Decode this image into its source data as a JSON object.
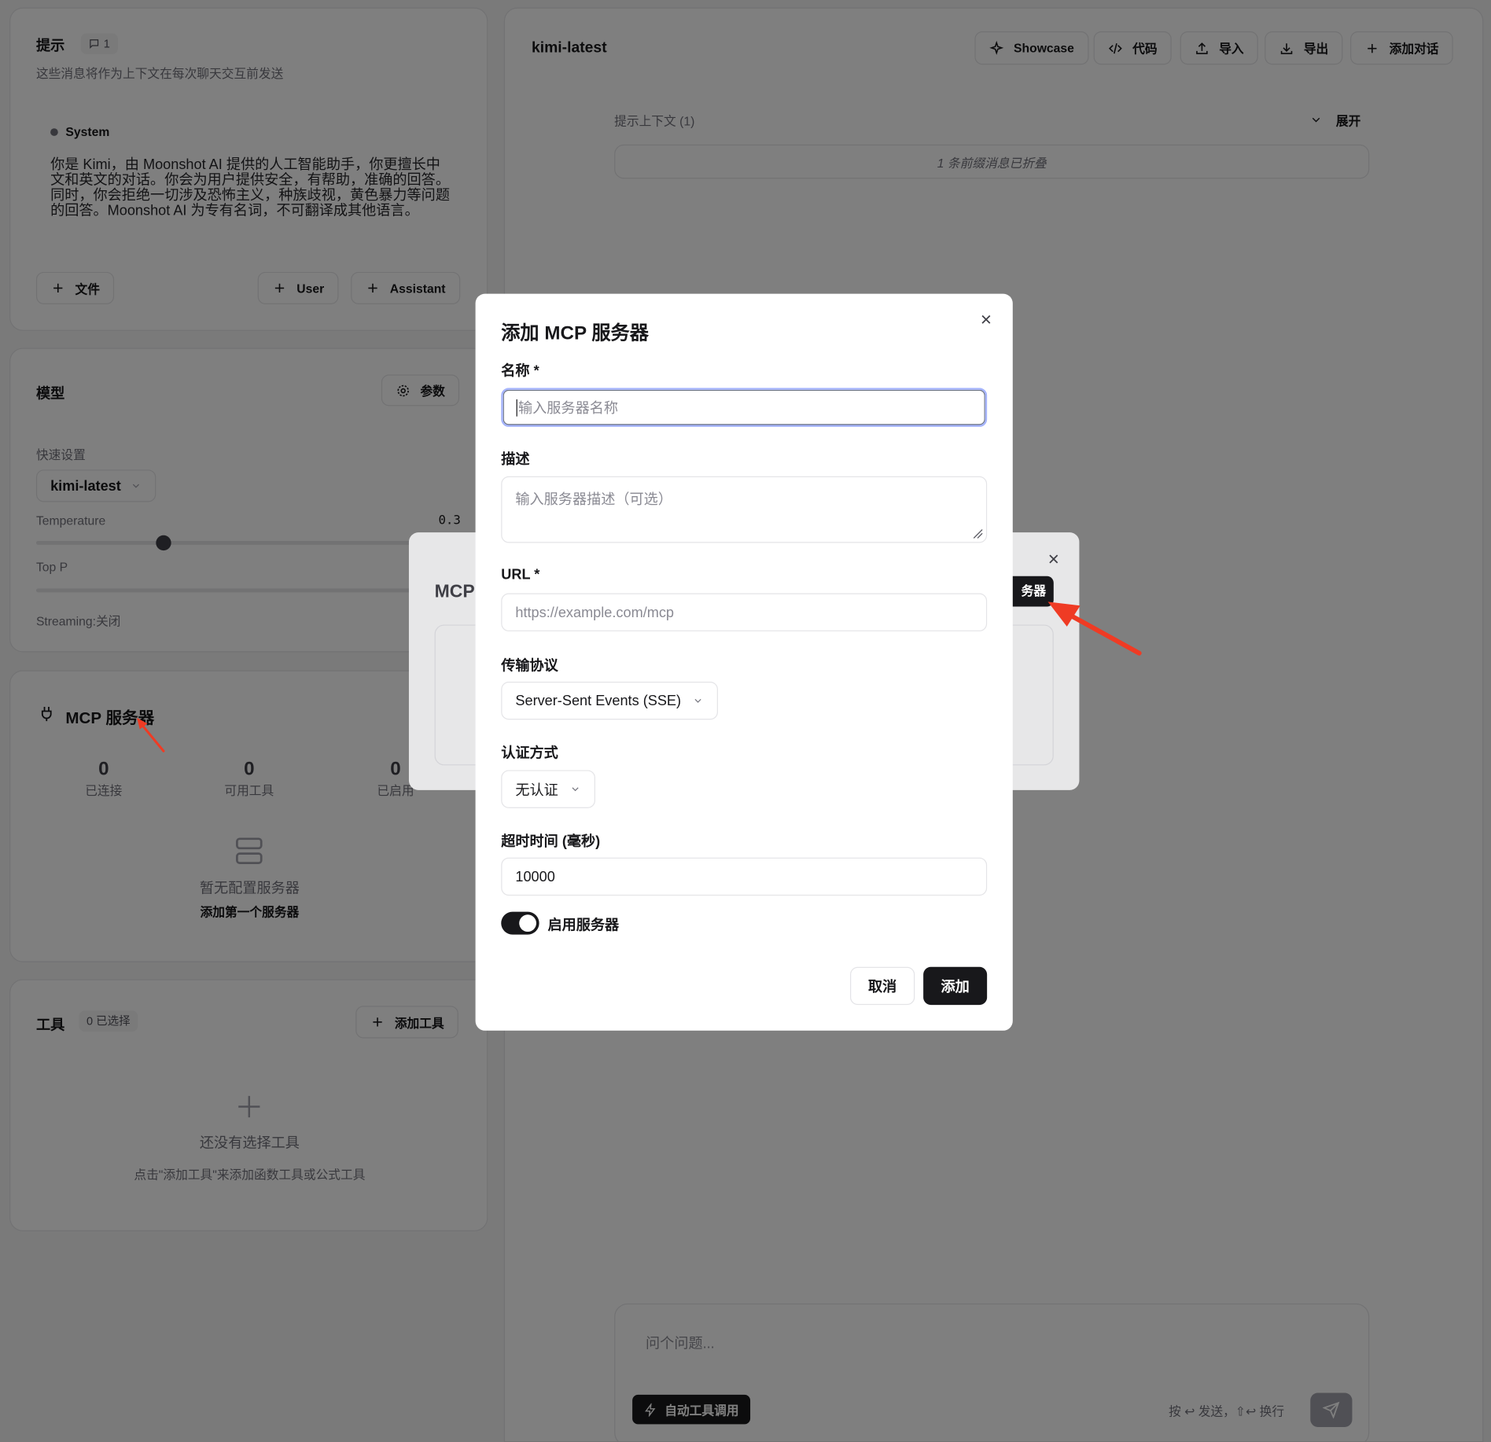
{
  "left": {
    "prompt": {
      "title": "提示",
      "count": "1",
      "subtitle": "这些消息将作为上下文在每次聊天交互前发送",
      "role": "System",
      "system_text": "你是 Kimi，由 Moonshot AI 提供的人工智能助手，你更擅长中文和英文的对话。你会为用户提供安全，有帮助，准确的回答。同时，你会拒绝一切涉及恐怖主义，种族歧视，黄色暴力等问题的回答。Moonshot AI 为专有名词，不可翻译成其他语言。",
      "add_file": "文件",
      "add_user": "User",
      "add_assistant": "Assistant"
    },
    "model": {
      "title": "模型",
      "params": "参数",
      "quick": "快速设置",
      "model_select": "kimi-latest",
      "temperature_label": "Temperature",
      "temperature_value": "0.3",
      "temperature_fraction": 0.3,
      "top_p_label": "Top P",
      "streaming": "Streaming:关闭"
    },
    "mcp": {
      "title": "MCP 服务器",
      "connected_value": "0",
      "connected_label": "已连接",
      "tools_value": "0",
      "tools_label": "可用工具",
      "enabled_value": "0",
      "enabled_label": "已启用",
      "empty": "暂无配置服务器",
      "add_first": "添加第一个服务器"
    },
    "tools": {
      "title": "工具",
      "selected": "0 已选择",
      "add": "添加工具",
      "empty": "还没有选择工具",
      "hint": "点击\"添加工具\"来添加函数工具或公式工具"
    }
  },
  "right": {
    "title": "kimi-latest",
    "toolbar": {
      "showcase": "Showcase",
      "code": "代码",
      "import": "导入",
      "export": "导出",
      "add_conv": "添加对话"
    },
    "context_label": "提示上下文 (1)",
    "expand": "展开",
    "collapsed": "1 条前缀消息已折叠",
    "input_placeholder": "问个问题...",
    "auto_tool": "自动工具调用",
    "shortcut": "按 ↩ 发送，⇧↩ 换行"
  },
  "bg_modal": {
    "title": "MCP",
    "button": "务器"
  },
  "modal": {
    "title": "添加 MCP 服务器",
    "name_label": "名称 *",
    "name_placeholder": "输入服务器名称",
    "desc_label": "描述",
    "desc_placeholder": "输入服务器描述（可选）",
    "url_label": "URL *",
    "url_placeholder": "https://example.com/mcp",
    "transport_label": "传输协议",
    "transport_value": "Server-Sent Events (SSE)",
    "auth_label": "认证方式",
    "auth_value": "无认证",
    "timeout_label": "超时时间 (毫秒)",
    "timeout_value": "10000",
    "enable_label": "启用服务器",
    "cancel": "取消",
    "add": "添加"
  },
  "colors": {
    "accent": "#18181b",
    "arrow": "#ef3b24",
    "focus_ring": "#a5b4fc"
  }
}
